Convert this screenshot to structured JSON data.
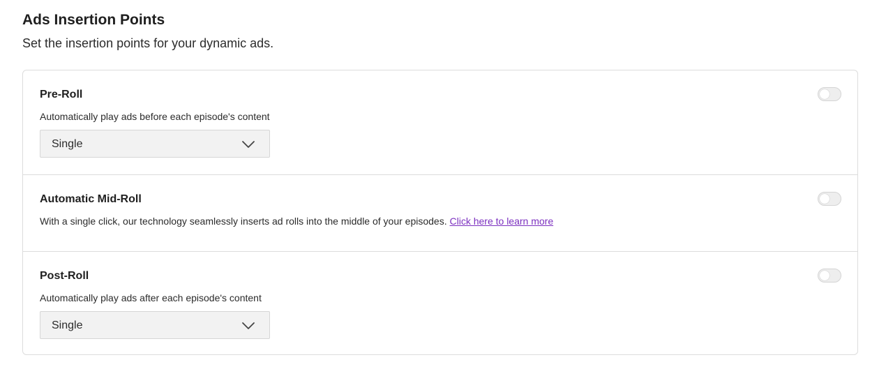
{
  "header": {
    "title": "Ads Insertion Points",
    "subtitle": "Set the insertion points for your dynamic ads."
  },
  "sections": [
    {
      "title": "Pre-Roll",
      "description": "Automatically play ads before each episode's content",
      "toggle_enabled": false,
      "select_value": "Single"
    },
    {
      "title": "Automatic Mid-Roll",
      "description": "With a single click, our technology seamlessly inserts ad rolls into the middle of your episodes.",
      "link_text": "Click here to learn more",
      "toggle_enabled": false
    },
    {
      "title": "Post-Roll",
      "description": "Automatically play ads after each episode's content",
      "toggle_enabled": false,
      "select_value": "Single"
    }
  ],
  "colors": {
    "link": "#7b2fbf",
    "border": "#dcdcdc",
    "select_bg": "#f2f2f2",
    "toggle_off": "#eeeeee"
  },
  "icons": {
    "select_arrow": "chevron-down-icon"
  }
}
